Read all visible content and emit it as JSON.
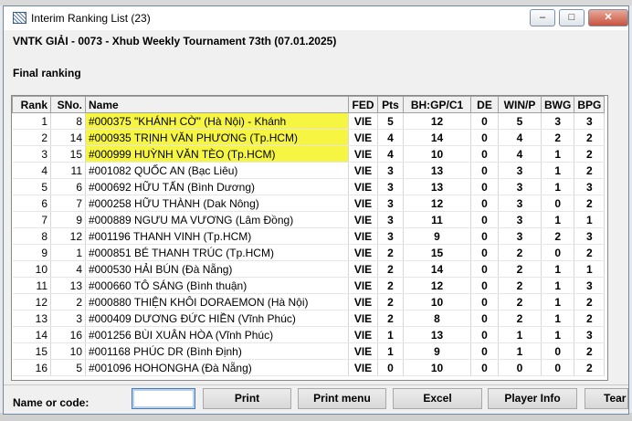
{
  "window": {
    "title": "Interim Ranking List (23)",
    "controls": {
      "minimize": "–",
      "maximize": "□",
      "close": "✕"
    }
  },
  "header": {
    "event_title": "VNTK GIẢI - 0073  - Xhub Weekly Tournament 73th (07.01.2025)",
    "section_label": "Final ranking"
  },
  "table": {
    "columns": [
      "Rank",
      "SNo.",
      "Name",
      "FED",
      "Pts",
      "BH:GP/C1",
      "DE",
      "WIN/P",
      "BWG",
      "BPG"
    ],
    "rows": [
      {
        "rank": "1",
        "sno": "8",
        "name": "#000375 \"KHÁNH CỜ\" (Hà Nội) - Khánh",
        "fed": "VIE",
        "pts": "5",
        "bh": "12",
        "de": "0",
        "win": "5",
        "bwg": "3",
        "bpg": "3",
        "highlight": true
      },
      {
        "rank": "2",
        "sno": "14",
        "name": "#000935 TRỊNH VĂN PHƯƠNG  (Tp.HCM)",
        "fed": "VIE",
        "pts": "4",
        "bh": "14",
        "de": "0",
        "win": "4",
        "bwg": "2",
        "bpg": "2",
        "highlight": true
      },
      {
        "rank": "3",
        "sno": "15",
        "name": "#000999 HUỲNH VĂN TÈO (Tp.HCM)",
        "fed": "VIE",
        "pts": "4",
        "bh": "10",
        "de": "0",
        "win": "4",
        "bwg": "1",
        "bpg": "2",
        "highlight": true
      },
      {
        "rank": "4",
        "sno": "11",
        "name": "#001082 QUỐC AN (Bạc Liêu)",
        "fed": "VIE",
        "pts": "3",
        "bh": "13",
        "de": "0",
        "win": "3",
        "bwg": "1",
        "bpg": "2",
        "highlight": false
      },
      {
        "rank": "5",
        "sno": "6",
        "name": "#000692 HỮU TẤN (Bình Dương)",
        "fed": "VIE",
        "pts": "3",
        "bh": "13",
        "de": "0",
        "win": "3",
        "bwg": "1",
        "bpg": "3",
        "highlight": false
      },
      {
        "rank": "6",
        "sno": "7",
        "name": "#000258 HỮU THÀNH (Dak Nông)",
        "fed": "VIE",
        "pts": "3",
        "bh": "12",
        "de": "0",
        "win": "3",
        "bwg": "0",
        "bpg": "2",
        "highlight": false
      },
      {
        "rank": "7",
        "sno": "9",
        "name": "#000889  NGƯU MA VƯƠNG (Lâm Đồng)",
        "fed": "VIE",
        "pts": "3",
        "bh": "11",
        "de": "0",
        "win": "3",
        "bwg": "1",
        "bpg": "1",
        "highlight": false
      },
      {
        "rank": "8",
        "sno": "12",
        "name": "#001196 THANH VINH (Tp.HCM)",
        "fed": "VIE",
        "pts": "3",
        "bh": "9",
        "de": "0",
        "win": "3",
        "bwg": "2",
        "bpg": "3",
        "highlight": false
      },
      {
        "rank": "9",
        "sno": "1",
        "name": "#000851 BÉ THANH TRÚC (Tp.HCM)",
        "fed": "VIE",
        "pts": "2",
        "bh": "15",
        "de": "0",
        "win": "2",
        "bwg": "0",
        "bpg": "2",
        "highlight": false
      },
      {
        "rank": "10",
        "sno": "4",
        "name": "#000530 HẢI BÚN (Đà Nẵng)",
        "fed": "VIE",
        "pts": "2",
        "bh": "14",
        "de": "0",
        "win": "2",
        "bwg": "1",
        "bpg": "1",
        "highlight": false
      },
      {
        "rank": "11",
        "sno": "13",
        "name": "#000660 TÔ SÁNG (Bình thuận)",
        "fed": "VIE",
        "pts": "2",
        "bh": "12",
        "de": "0",
        "win": "2",
        "bwg": "1",
        "bpg": "3",
        "highlight": false
      },
      {
        "rank": "12",
        "sno": "2",
        "name": "#000880 THIỆN KHÔI DORAEMON (Hà Nội)",
        "fed": "VIE",
        "pts": "2",
        "bh": "10",
        "de": "0",
        "win": "2",
        "bwg": "1",
        "bpg": "2",
        "highlight": false
      },
      {
        "rank": "13",
        "sno": "3",
        "name": "#000409 DƯƠNG ĐỨC HIỀN (Vĩnh Phúc)",
        "fed": "VIE",
        "pts": "2",
        "bh": "8",
        "de": "0",
        "win": "2",
        "bwg": "1",
        "bpg": "2",
        "highlight": false
      },
      {
        "rank": "14",
        "sno": "16",
        "name": "#001256 BÙI XUÂN HÒA (Vĩnh Phúc)",
        "fed": "VIE",
        "pts": "1",
        "bh": "13",
        "de": "0",
        "win": "1",
        "bwg": "1",
        "bpg": "3",
        "highlight": false
      },
      {
        "rank": "15",
        "sno": "10",
        "name": "#001168 PHÚC DR (Bình Định)",
        "fed": "VIE",
        "pts": "1",
        "bh": "9",
        "de": "0",
        "win": "1",
        "bwg": "0",
        "bpg": "2",
        "highlight": false
      },
      {
        "rank": "16",
        "sno": "5",
        "name": "#001096 HOHONGHA (Đà Nẵng)",
        "fed": "VIE",
        "pts": "0",
        "bh": "10",
        "de": "0",
        "win": "0",
        "bwg": "0",
        "bpg": "2",
        "highlight": false
      }
    ]
  },
  "footer": {
    "name_label": "Name or code:",
    "name_value": "",
    "buttons": {
      "print": "Print",
      "print_menu": "Print menu",
      "excel": "Excel",
      "player_info": "Player Info",
      "team": "Tear"
    }
  },
  "colors": {
    "highlight": "#f5f542",
    "title_border": "#6f8aa8",
    "close": "#c7533f"
  }
}
